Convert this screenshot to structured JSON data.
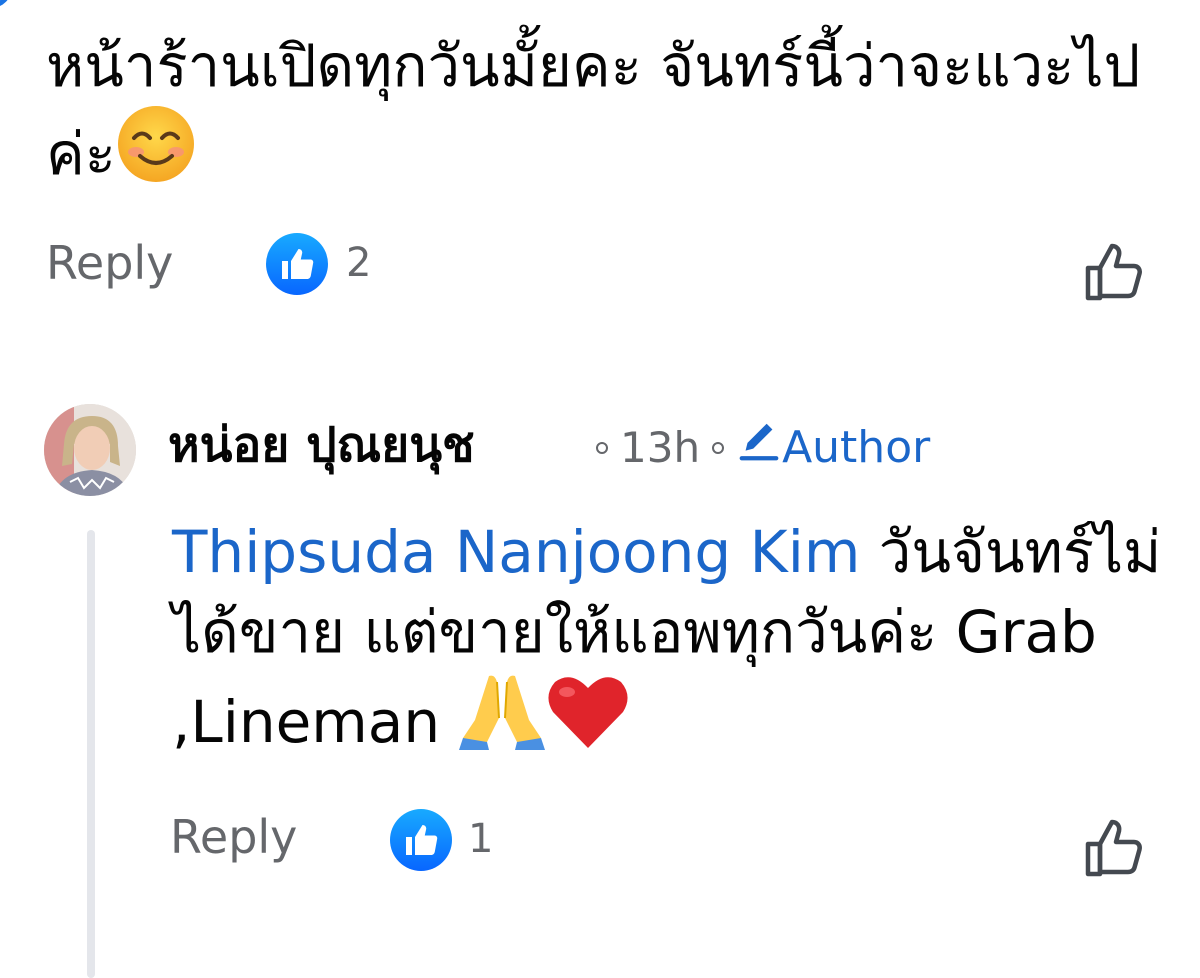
{
  "comment1": {
    "text": "หน้าร้านเปิดทุกวันมั้ยคะ จันทร์นี้ว่าจะแวะไปค่ะ",
    "reply_label": "Reply",
    "like_count": "2"
  },
  "comment2": {
    "author": "หน่อย ปุณยนุช",
    "time": "13h",
    "author_badge": "Author",
    "mention": "Thipsuda Nanjoong Kim",
    "text": " วันจันทร์ไม่ได้ขาย แต่ขายให้แอพทุกวันค่ะ Grab ,Lineman ",
    "reply_label": "Reply",
    "like_count": "1"
  },
  "colors": {
    "link_blue": "#1b66c9",
    "secondary_text": "#65676b",
    "like_badge": "#0866ff",
    "thread_line": "#e4e6eb"
  },
  "icons": [
    "smiling-face-emoji",
    "like-badge-icon",
    "like-outline-icon",
    "pencil-icon",
    "folded-hands-emoji",
    "red-heart-emoji"
  ]
}
